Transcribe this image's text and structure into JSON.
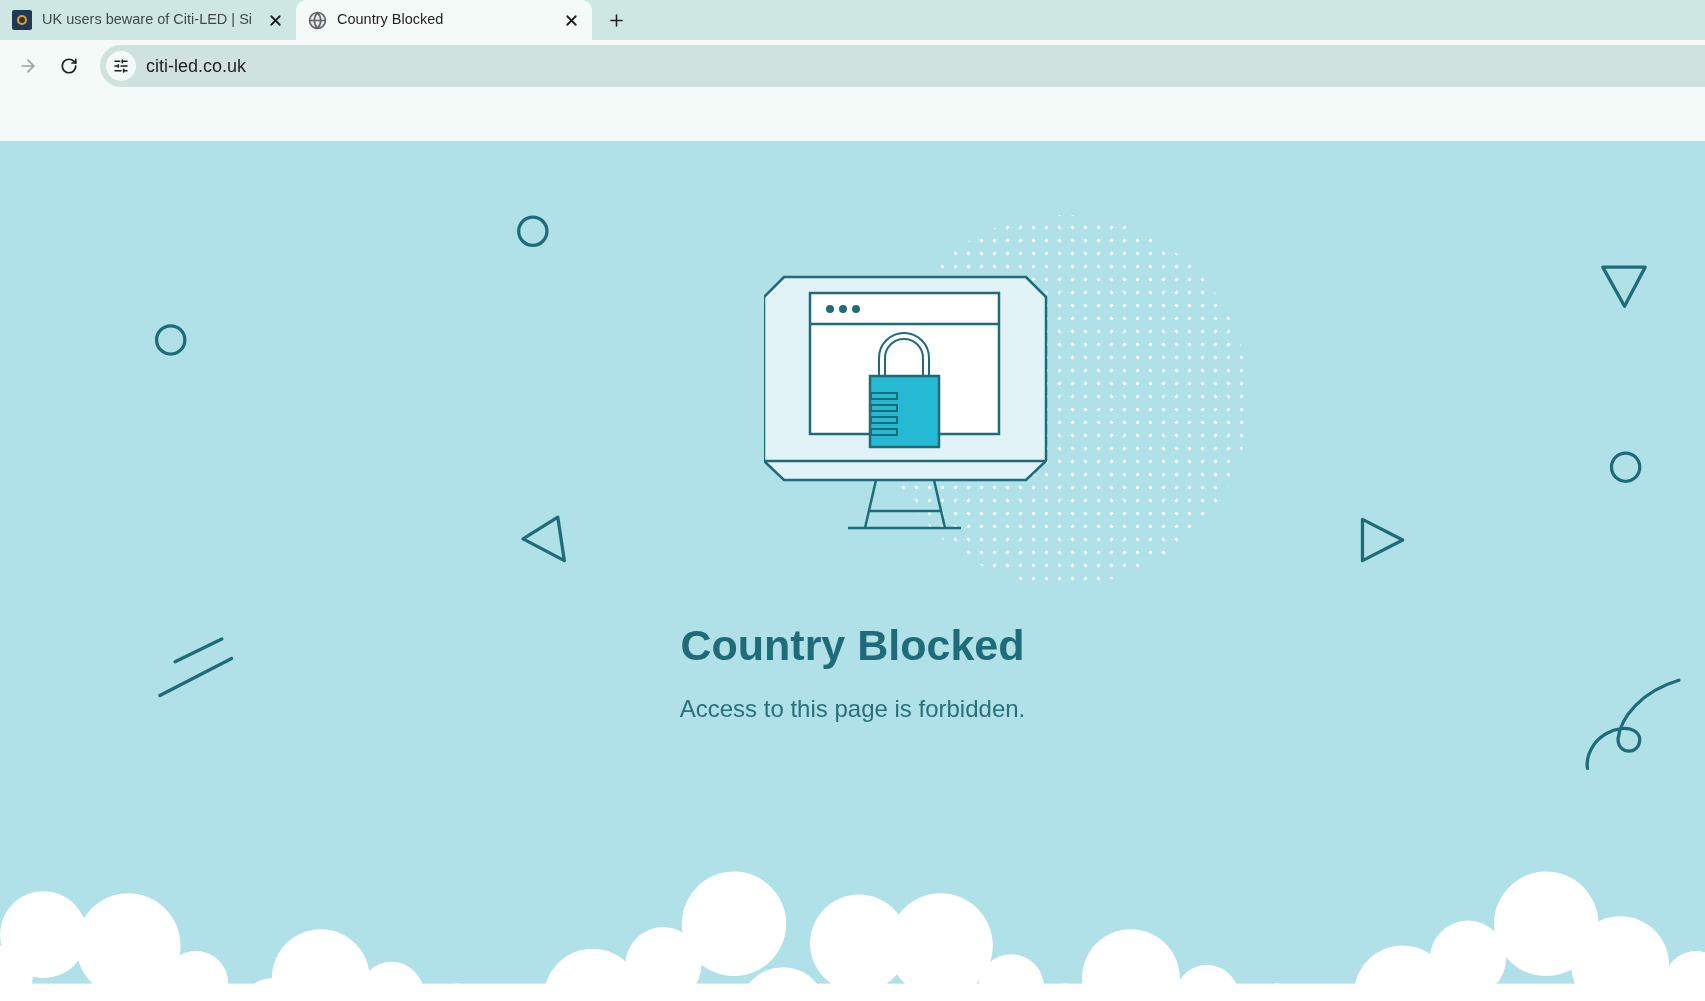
{
  "tabs": [
    {
      "title": "UK users beware of Citi-LED | Si",
      "selected": false
    },
    {
      "title": "Country Blocked",
      "selected": true
    }
  ],
  "address_bar": {
    "url": "citi-led.co.uk"
  },
  "page": {
    "heading": "Country Blocked",
    "message": "Access to this page is forbidden."
  }
}
